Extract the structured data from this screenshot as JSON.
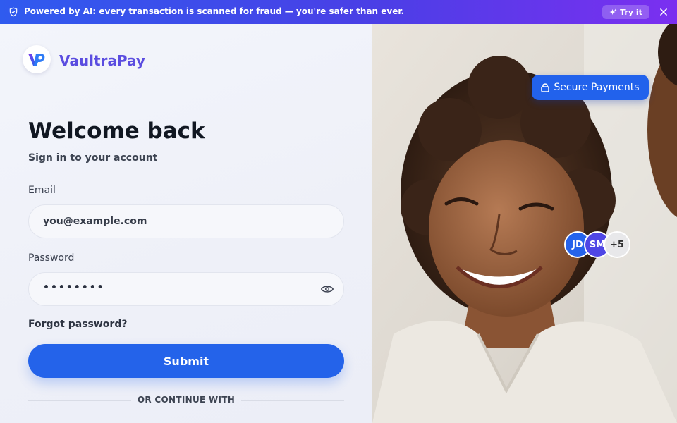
{
  "banner": {
    "message": "Powered by AI: every transaction is scanned for fraud — you're safer than ever.",
    "cta_label": "Try it",
    "icon": "shield-icon",
    "gradient": [
      "#2f5bef",
      "#7b2ff0"
    ]
  },
  "brand": {
    "name": "VaultraPay",
    "color": "#5b4de0"
  },
  "login": {
    "title": "Welcome back",
    "subtitle": "Sign in to your account",
    "email_label": "Email",
    "email_placeholder": "you@example.com",
    "password_label": "Password",
    "password_mask": "••••••••",
    "forgot_label": "Forgot password?",
    "submit_label": "Submit",
    "divider_text": "OR CONTINUE WITH"
  },
  "hero": {
    "badge_label": "Secure Payments",
    "avatars": [
      {
        "initials": "JD",
        "color": "#2563eb"
      },
      {
        "initials": "SM",
        "color": "#4f46e5"
      }
    ],
    "avatar_more": "+5"
  },
  "colors": {
    "accent": "#2463ea",
    "text": "#111722"
  }
}
